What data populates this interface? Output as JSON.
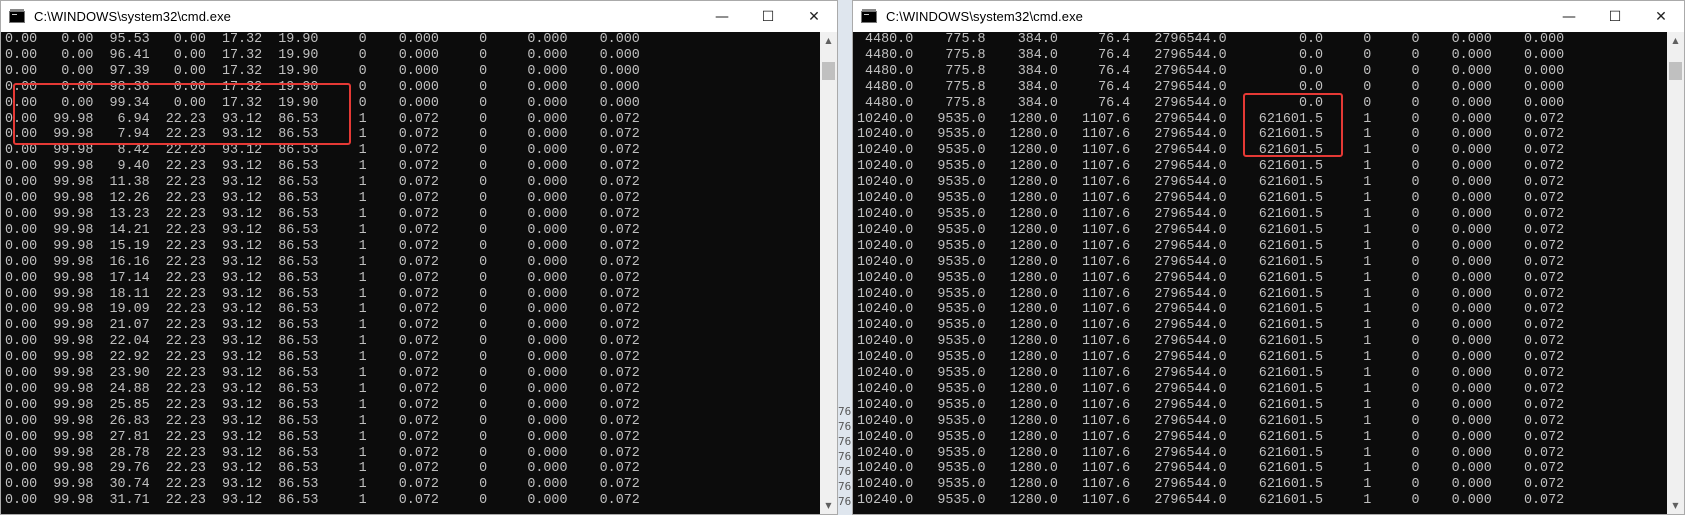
{
  "left_window": {
    "title": "C:\\WINDOWS\\system32\\cmd.exe",
    "minimize_glyph": "—",
    "maximize_glyph": "☐",
    "close_glyph": "✕",
    "icon": "console-app-icon",
    "lines": [
      "0.00   0.00  95.53   0.00  17.32  19.90     0    0.000     0     0.000    0.000",
      "0.00   0.00  96.41   0.00  17.32  19.90     0    0.000     0     0.000    0.000",
      "0.00   0.00  97.39   0.00  17.32  19.90     0    0.000     0     0.000    0.000",
      "0.00   0.00  98.36   0.00  17.32  19.90     0    0.000     0     0.000    0.000",
      "0.00   0.00  99.34   0.00  17.32  19.90     0    0.000     0     0.000    0.000",
      "0.00  99.98   6.94  22.23  93.12  86.53     1    0.072     0     0.000    0.072",
      "0.00  99.98   7.94  22.23  93.12  86.53     1    0.072     0     0.000    0.072",
      "0.00  99.98   8.42  22.23  93.12  86.53     1    0.072     0     0.000    0.072",
      "0.00  99.98   9.40  22.23  93.12  86.53     1    0.072     0     0.000    0.072",
      "0.00  99.98  11.38  22.23  93.12  86.53     1    0.072     0     0.000    0.072",
      "0.00  99.98  12.26  22.23  93.12  86.53     1    0.072     0     0.000    0.072",
      "0.00  99.98  13.23  22.23  93.12  86.53     1    0.072     0     0.000    0.072",
      "0.00  99.98  14.21  22.23  93.12  86.53     1    0.072     0     0.000    0.072",
      "0.00  99.98  15.19  22.23  93.12  86.53     1    0.072     0     0.000    0.072",
      "0.00  99.98  16.16  22.23  93.12  86.53     1    0.072     0     0.000    0.072",
      "0.00  99.98  17.14  22.23  93.12  86.53     1    0.072     0     0.000    0.072",
      "0.00  99.98  18.11  22.23  93.12  86.53     1    0.072     0     0.000    0.072",
      "0.00  99.98  19.09  22.23  93.12  86.53     1    0.072     0     0.000    0.072",
      "0.00  99.98  21.07  22.23  93.12  86.53     1    0.072     0     0.000    0.072",
      "0.00  99.98  22.04  22.23  93.12  86.53     1    0.072     0     0.000    0.072",
      "0.00  99.98  22.92  22.23  93.12  86.53     1    0.072     0     0.000    0.072",
      "0.00  99.98  23.90  22.23  93.12  86.53     1    0.072     0     0.000    0.072",
      "0.00  99.98  24.88  22.23  93.12  86.53     1    0.072     0     0.000    0.072",
      "0.00  99.98  25.85  22.23  93.12  86.53     1    0.072     0     0.000    0.072",
      "0.00  99.98  26.83  22.23  93.12  86.53     1    0.072     0     0.000    0.072",
      "0.00  99.98  27.81  22.23  93.12  86.53     1    0.072     0     0.000    0.072",
      "0.00  99.98  28.78  22.23  93.12  86.53     1    0.072     0     0.000    0.072",
      "0.00  99.98  29.76  22.23  93.12  86.53     1    0.072     0     0.000    0.072",
      "0.00  99.98  30.74  22.23  93.12  86.53     1    0.072     0     0.000    0.072",
      "0.00  99.98  31.71  22.23  93.12  86.53     1    0.072     0     0.000    0.072"
    ]
  },
  "right_window": {
    "title": "C:\\WINDOWS\\system32\\cmd.exe",
    "minimize_glyph": "—",
    "maximize_glyph": "☐",
    "close_glyph": "✕",
    "icon": "console-app-icon",
    "lines": [
      " 4480.0    775.8    384.0     76.4   2796544.0         0.0     0     0    0.000    0.000",
      " 4480.0    775.8    384.0     76.4   2796544.0         0.0     0     0    0.000    0.000",
      " 4480.0    775.8    384.0     76.4   2796544.0         0.0     0     0    0.000    0.000",
      " 4480.0    775.8    384.0     76.4   2796544.0         0.0     0     0    0.000    0.000",
      " 4480.0    775.8    384.0     76.4   2796544.0         0.0     0     0    0.000    0.000",
      "10240.0   9535.0   1280.0   1107.6   2796544.0    621601.5     1     0    0.000    0.072",
      "10240.0   9535.0   1280.0   1107.6   2796544.0    621601.5     1     0    0.000    0.072",
      "10240.0   9535.0   1280.0   1107.6   2796544.0    621601.5     1     0    0.000    0.072",
      "10240.0   9535.0   1280.0   1107.6   2796544.0    621601.5     1     0    0.000    0.072",
      "10240.0   9535.0   1280.0   1107.6   2796544.0    621601.5     1     0    0.000    0.072",
      "10240.0   9535.0   1280.0   1107.6   2796544.0    621601.5     1     0    0.000    0.072",
      "10240.0   9535.0   1280.0   1107.6   2796544.0    621601.5     1     0    0.000    0.072",
      "10240.0   9535.0   1280.0   1107.6   2796544.0    621601.5     1     0    0.000    0.072",
      "10240.0   9535.0   1280.0   1107.6   2796544.0    621601.5     1     0    0.000    0.072",
      "10240.0   9535.0   1280.0   1107.6   2796544.0    621601.5     1     0    0.000    0.072",
      "10240.0   9535.0   1280.0   1107.6   2796544.0    621601.5     1     0    0.000    0.072",
      "10240.0   9535.0   1280.0   1107.6   2796544.0    621601.5     1     0    0.000    0.072",
      "10240.0   9535.0   1280.0   1107.6   2796544.0    621601.5     1     0    0.000    0.072",
      "10240.0   9535.0   1280.0   1107.6   2796544.0    621601.5     1     0    0.000    0.072",
      "10240.0   9535.0   1280.0   1107.6   2796544.0    621601.5     1     0    0.000    0.072",
      "10240.0   9535.0   1280.0   1107.6   2796544.0    621601.5     1     0    0.000    0.072",
      "10240.0   9535.0   1280.0   1107.6   2796544.0    621601.5     1     0    0.000    0.072",
      "10240.0   9535.0   1280.0   1107.6   2796544.0    621601.5     1     0    0.000    0.072",
      "10240.0   9535.0   1280.0   1107.6   2796544.0    621601.5     1     0    0.000    0.072",
      "10240.0   9535.0   1280.0   1107.6   2796544.0    621601.5     1     0    0.000    0.072",
      "10240.0   9535.0   1280.0   1107.6   2796544.0    621601.5     1     0    0.000    0.072",
      "10240.0   9535.0   1280.0   1107.6   2796544.0    621601.5     1     0    0.000    0.072",
      "10240.0   9535.0   1280.0   1107.6   2796544.0    621601.5     1     0    0.000    0.072",
      "10240.0   9535.0   1280.0   1107.6   2796544.0    621601.5     1     0    0.000    0.072",
      "10240.0   9535.0   1280.0   1107.6   2796544.0    621601.5     1     0    0.000    0.072"
    ]
  },
  "background_fragments": [
    "76.",
    "76.",
    "76.",
    "76.",
    "76.",
    "76.",
    "76."
  ],
  "colors": {
    "console_bg": "#0c0c0c",
    "console_text": "#c0c0c0",
    "highlight": "#e53935"
  }
}
